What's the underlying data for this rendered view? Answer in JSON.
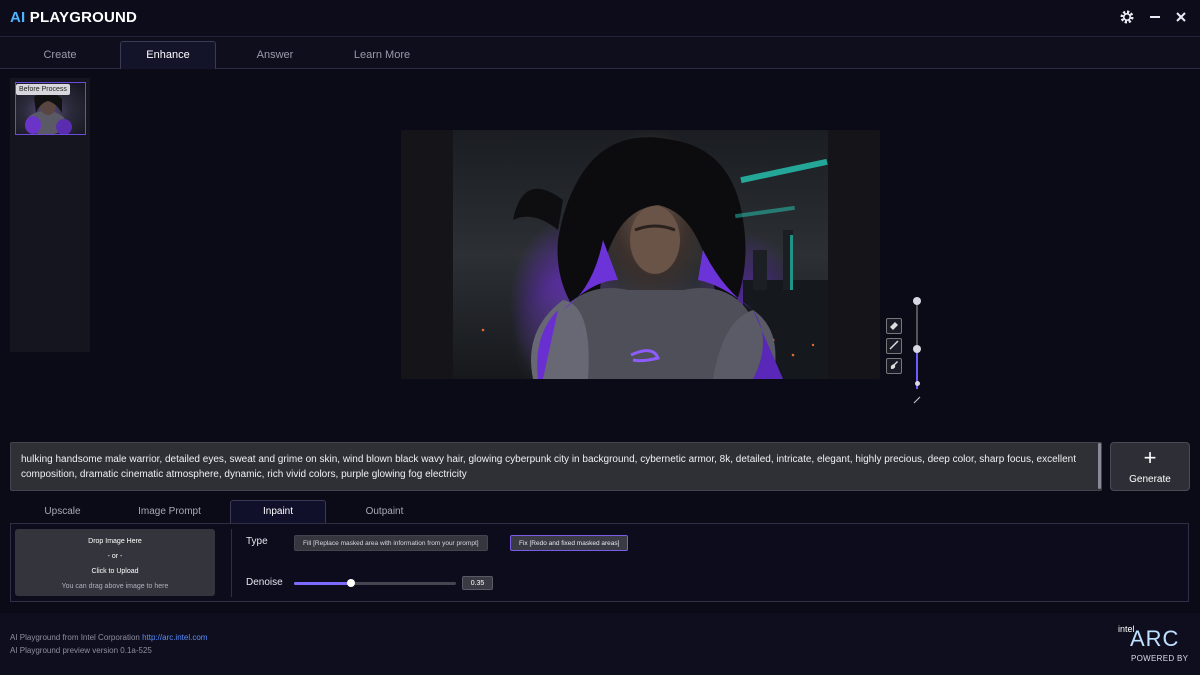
{
  "app": {
    "title_accent": "AI",
    "title_rest": "PLAYGROUND"
  },
  "header": {
    "icons": [
      "gear-icon",
      "minimize-icon",
      "close-icon"
    ]
  },
  "tabs": [
    {
      "label": "Create"
    },
    {
      "label": "Enhance"
    },
    {
      "label": "Answer"
    },
    {
      "label": "Learn More"
    }
  ],
  "history": {
    "thumb_label": "Before Process"
  },
  "prompt": {
    "text": "hulking handsome male warrior, detailed eyes, sweat and grime on skin, wind blown black wavy hair, glowing cyberpunk city in background, cybernetic armor, 8k, detailed, intricate, elegant, highly precious, deep color, sharp focus, excellent composition, dramatic cinematic atmosphere, dynamic, rich vivid colors, purple glowing fog electricity"
  },
  "generate": {
    "plus": "+",
    "label": "Generate"
  },
  "sub_tabs": [
    {
      "label": "Upscale"
    },
    {
      "label": "Image Prompt"
    },
    {
      "label": "Inpaint"
    },
    {
      "label": "Outpaint"
    }
  ],
  "upload": {
    "line1": "Drop Image Here",
    "line2": "- or -",
    "line3": "Click to Upload",
    "hint": "You can drag above image to here"
  },
  "inpaint": {
    "type_label": "Type",
    "fill_option": "Fill [Replace masked area with information from your prompt]",
    "fix_option": "Fix [Redo and fixed masked areas]",
    "denoise_label": "Denoise",
    "denoise_value": "0.35",
    "denoise_fraction": 0.35
  },
  "brush": {
    "size_fraction": 0.45
  },
  "footer": {
    "line1_prefix": "AI Playground from Intel Corporation",
    "line1_link": "http://arc.intel.com",
    "line2": "AI Playground preview version 0.1a-525"
  },
  "brand": {
    "intel": "intel",
    "arc": "ARC",
    "powered": "POWERED BY"
  },
  "colors": {
    "accent": "#7b6cff",
    "logo_ai": "#4fb3ff",
    "link": "#5a8dff"
  }
}
